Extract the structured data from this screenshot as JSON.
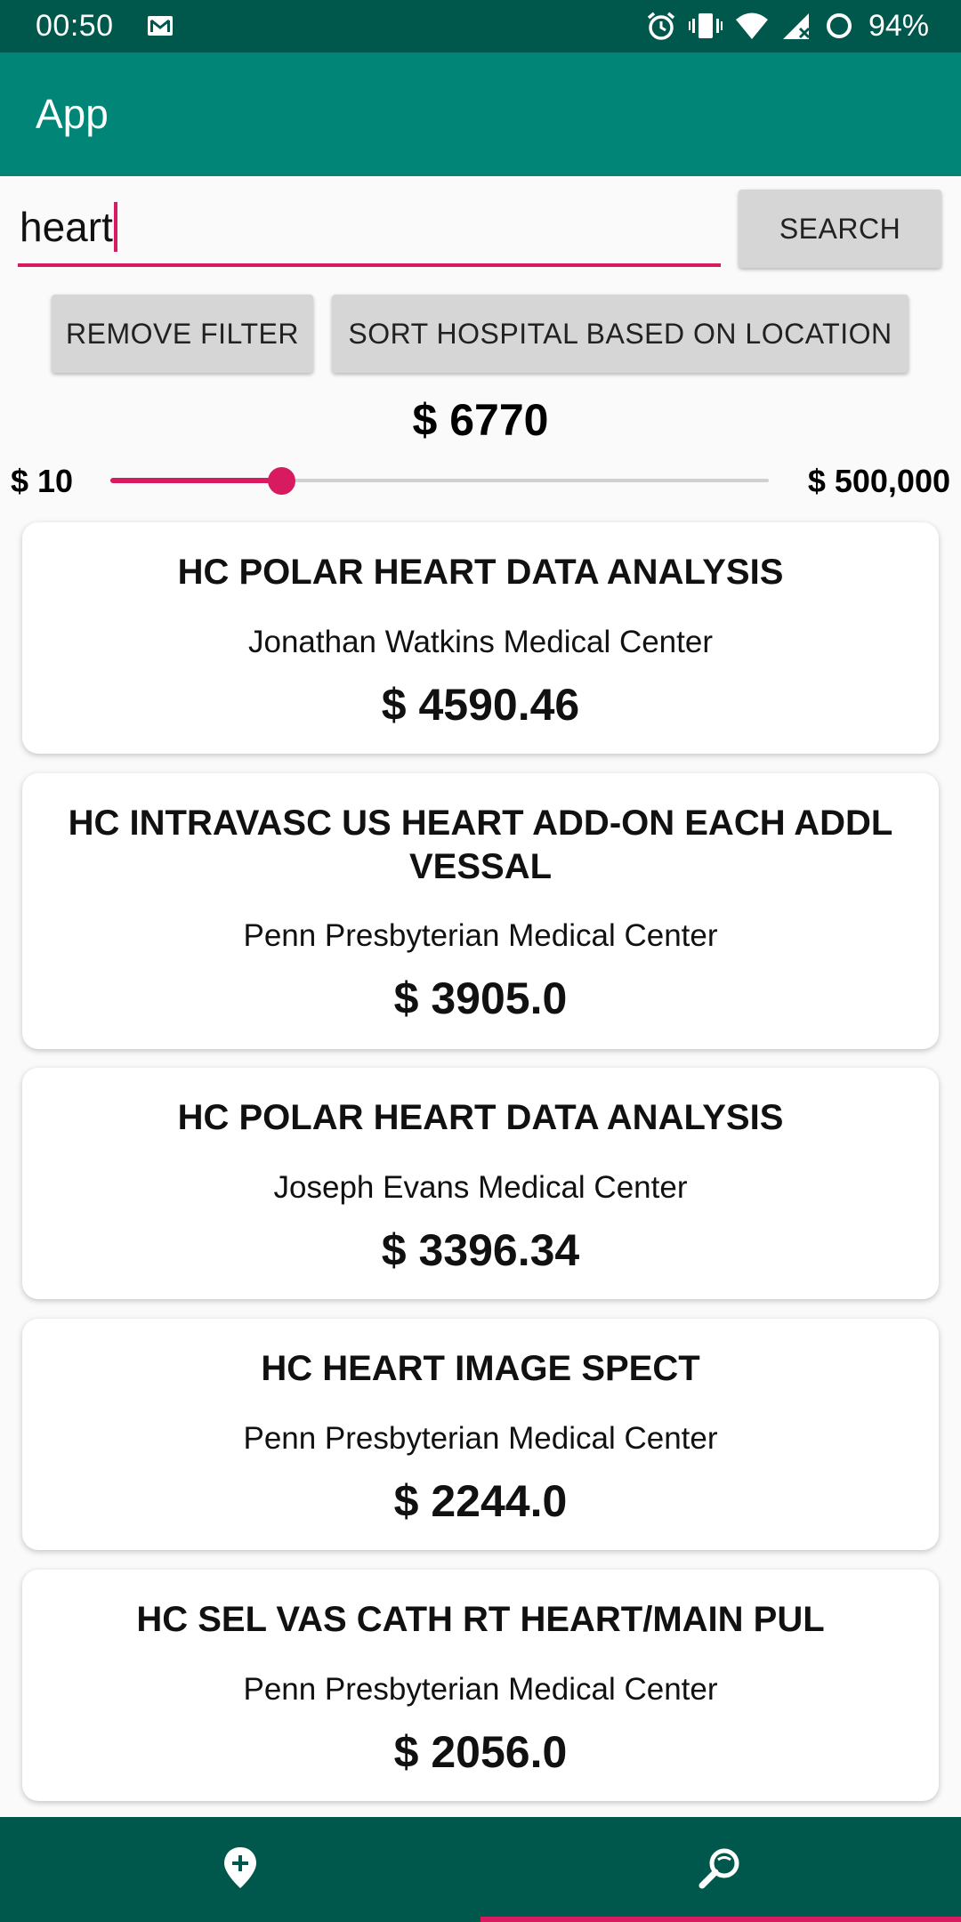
{
  "status_bar": {
    "time": "00:50",
    "battery_percent": "94%",
    "icons": [
      "mail-icon",
      "alarm-icon",
      "vibrate-icon",
      "wifi-icon",
      "signal-icon",
      "battery-icon"
    ]
  },
  "app_bar": {
    "title": "App"
  },
  "search": {
    "value": "heart",
    "button_label": "SEARCH"
  },
  "filters": {
    "remove_filter_label": "REMOVE FILTER",
    "sort_label": "SORT HOSPITAL BASED ON LOCATION"
  },
  "price_slider": {
    "current_label": "$ 6770",
    "min_label": "$ 10",
    "max_label": "$ 500,000",
    "fill_fraction": 0.26
  },
  "results": [
    {
      "title": "HC POLAR HEART DATA ANALYSIS",
      "hospital": "Jonathan Watkins Medical Center",
      "price": "$ 4590.46"
    },
    {
      "title": "HC INTRAVASC US HEART ADD-ON EACH ADDL VESSAL",
      "hospital": "Penn Presbyterian Medical Center",
      "price": "$ 3905.0"
    },
    {
      "title": "HC POLAR HEART DATA ANALYSIS",
      "hospital": "Joseph Evans Medical Center",
      "price": "$ 3396.34"
    },
    {
      "title": "HC HEART IMAGE SPECT",
      "hospital": "Penn Presbyterian Medical Center",
      "price": "$ 2244.0"
    },
    {
      "title": "HC SEL VAS CATH RT HEART/MAIN PUL",
      "hospital": "Penn Presbyterian Medical Center",
      "price": "$ 2056.0"
    }
  ],
  "bottom_nav": {
    "items": [
      {
        "icon": "add-location-icon",
        "selected": false
      },
      {
        "icon": "search-icon",
        "selected": true
      }
    ]
  },
  "colors": {
    "primary_dark": "#00574b",
    "primary": "#008577",
    "accent": "#d81b60"
  }
}
